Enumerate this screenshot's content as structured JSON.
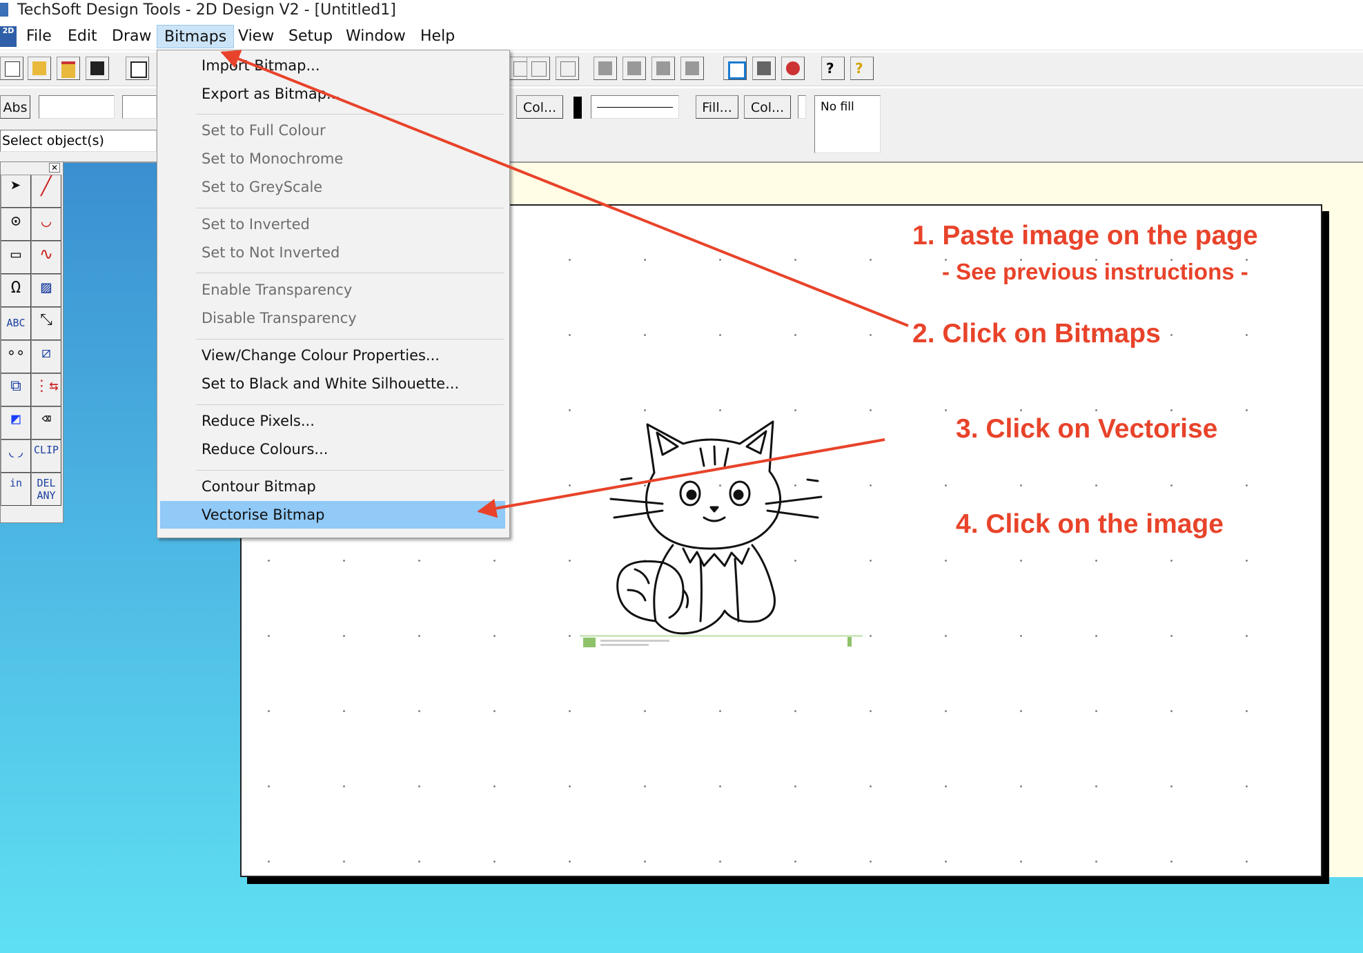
{
  "window": {
    "title": "TechSoft Design Tools - 2D Design V2 - [Untitled1]",
    "app_icon_label": "2D"
  },
  "menubar": {
    "items": [
      "File",
      "Edit",
      "Draw",
      "Bitmaps",
      "View",
      "Setup",
      "Window",
      "Help"
    ],
    "active": "Bitmaps"
  },
  "toolbar2": {
    "abs_label": "Abs",
    "col_label": "Col...",
    "fill_label": "Fill...",
    "col2_label": "Col...",
    "fill_status": "No fill"
  },
  "status": {
    "prompt": "Select object(s)"
  },
  "palette": {
    "text_tool": "ABC",
    "clip": "CLIP",
    "del": "DEL",
    "any": "ANY",
    "in": "in"
  },
  "dropdown": {
    "groups": [
      [
        {
          "label": "Import Bitmap...",
          "enabled": true
        },
        {
          "label": "Export as Bitmap...",
          "enabled": true
        }
      ],
      [
        {
          "label": "Set to Full Colour",
          "enabled": false
        },
        {
          "label": "Set to Monochrome",
          "enabled": false
        },
        {
          "label": "Set to GreyScale",
          "enabled": false
        }
      ],
      [
        {
          "label": "Set to Inverted",
          "enabled": false
        },
        {
          "label": "Set to Not Inverted",
          "enabled": false
        }
      ],
      [
        {
          "label": "Enable Transparency",
          "enabled": false
        },
        {
          "label": "Disable Transparency",
          "enabled": false
        }
      ],
      [
        {
          "label": "View/Change Colour Properties...",
          "enabled": true
        },
        {
          "label": "Set to Black and White Silhouette...",
          "enabled": true
        }
      ],
      [
        {
          "label": "Reduce Pixels...",
          "enabled": true
        },
        {
          "label": "Reduce Colours...",
          "enabled": true
        }
      ],
      [
        {
          "label": "Contour Bitmap",
          "enabled": true
        },
        {
          "label": "Vectorise Bitmap",
          "enabled": true,
          "selected": true
        }
      ]
    ]
  },
  "annotations": {
    "step1": "1. Paste image on the page",
    "step1_sub": "- See previous instructions -",
    "step2": "2. Click on Bitmaps",
    "step3": "3. Click on Vectorise",
    "step4": "4. Click on the image"
  },
  "colors": {
    "annotation": "#e8432a",
    "menu_highlight": "#91c9f7",
    "workspace_top": "#3a8fd0",
    "workspace_bottom": "#5fe0f2"
  },
  "image": {
    "subject": "cartoon-cat-line-drawing"
  }
}
